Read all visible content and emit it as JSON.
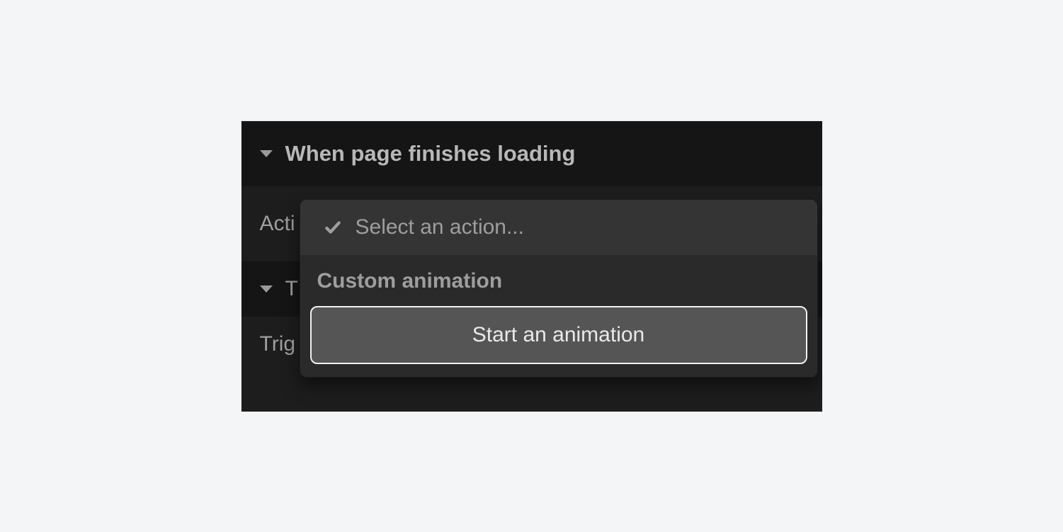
{
  "sections": {
    "page_load": {
      "title": "When page finishes loading",
      "action_label_partial": "Acti",
      "trigger_section_initial": "T",
      "trigger_label_partial": "Trig"
    }
  },
  "dropdown": {
    "placeholder": "Select an action...",
    "group_label": "Custom animation",
    "option_start_animation": "Start an animation"
  }
}
